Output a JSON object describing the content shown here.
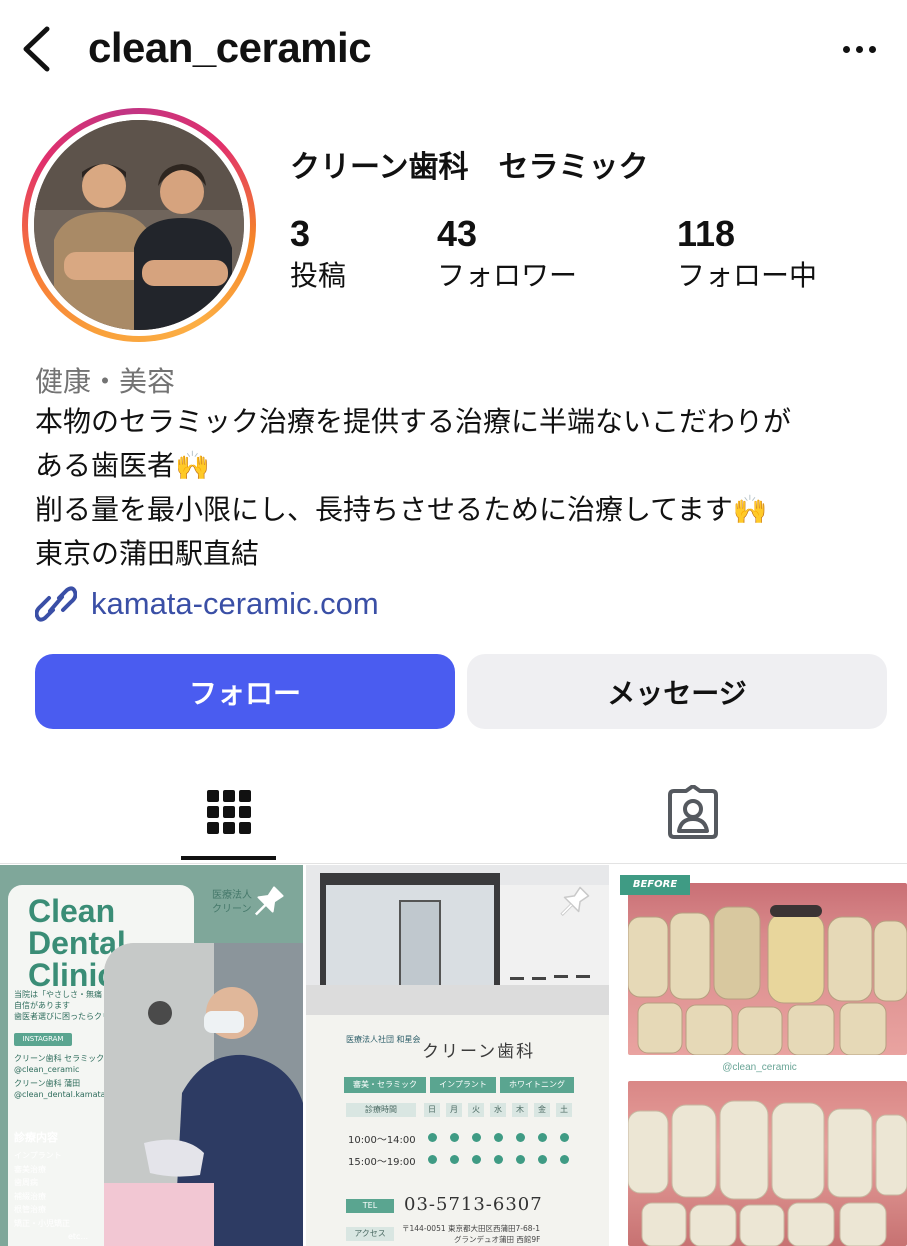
{
  "header": {
    "username": "clean_ceramic",
    "back_icon": "chevron-left-icon",
    "more_icon": "more-horizontal-icon"
  },
  "profile": {
    "display_name": "クリーン歯科　セラミック",
    "stats": [
      {
        "value": "3",
        "label": "投稿"
      },
      {
        "value": "43",
        "label": "フォロワー"
      },
      {
        "value": "118",
        "label": "フォロー中"
      }
    ],
    "category": "健康・美容",
    "bio_lines": [
      "本物のセラミック治療を提供する治療に半端ないこだわりが",
      "ある歯医者🙌",
      "削る量を最小限にし、長持ちさせるために治療してます🙌",
      "東京の蒲田駅直結"
    ],
    "link": "kamata-ceramic.com"
  },
  "actions": {
    "follow": "フォロー",
    "message": "メッセージ"
  },
  "tabs": {
    "grid_icon": "grid-icon",
    "tagged_icon": "tagged-person-icon",
    "active": "grid"
  },
  "posts": {
    "post1": {
      "title": [
        "Clean",
        "Dental",
        "Clinic"
      ],
      "corner_text": [
        "医療法人",
        "クリーン"
      ],
      "tagline": [
        "当院は「やさしさ・無痛・圧倒的技術力」に",
        "自信があります",
        "歯医者選びに困ったらクリーン歯科へ"
      ],
      "instagram_tag": "INSTAGRAM",
      "accounts": [
        "クリーン歯科 セラミック",
        "@clean_ceramic",
        "クリーン歯科 蒲田",
        "@clean_dental.kamata"
      ],
      "services_title": "診療内容",
      "services": [
        "インプラント",
        "審美治療",
        "歯周病",
        "補綴治療",
        "根管治療",
        "矯正・小児矯正"
      ],
      "etc": "etc..."
    },
    "post2": {
      "logo_text": [
        "医療法人社団 和星会"
      ],
      "clinic_name": "クリーン歯科",
      "chips": [
        "審美・セラミック",
        "インプラント",
        "ホワイトニング"
      ],
      "hours_header": "診療時間",
      "days": [
        "日",
        "月",
        "火",
        "水",
        "木",
        "金",
        "土"
      ],
      "times": [
        "10:00～14:00",
        "15:00～19:00"
      ],
      "tel_label": "TEL",
      "tel": "03-5713-6307",
      "access_label": "アクセス",
      "address": [
        "〒144-0051 東京都大田区西蒲田7-68-1",
        "グランデュオ蒲田 西館9F"
      ]
    },
    "post3": {
      "before_label": "BEFORE",
      "handle": "@clean_ceramic"
    }
  },
  "colors": {
    "follow_button": "#4a5cf0",
    "link": "#3a4fa6",
    "teal": "#3f9b84"
  }
}
